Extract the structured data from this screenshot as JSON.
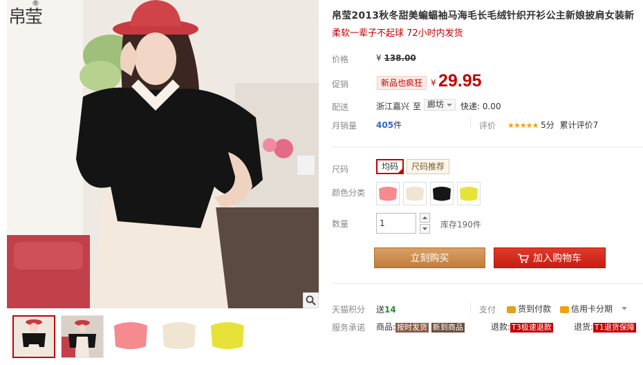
{
  "brand": {
    "logo_text": "帛莹",
    "reg_mark": "®"
  },
  "product": {
    "title": "帛莹2013秋冬甜美蝙蝠袖马海毛长毛绒针织开衫公主新娘披肩女装新",
    "subtitle": "柔软一辈子不起球 72小时内发货"
  },
  "price": {
    "label": "价格",
    "currency": "¥",
    "original": "138.00",
    "promo_label": "促销",
    "promo_badge": "新品也疯狂",
    "promo_currency": "¥",
    "promo_price": "29.95"
  },
  "delivery": {
    "label": "配送",
    "from": "浙江嘉兴",
    "to_word": "至",
    "city": "廊坊",
    "express": "快递: 0.00"
  },
  "sales": {
    "label": "月销量",
    "count": "405",
    "unit": "件",
    "rating_label": "评价",
    "stars": "★★★★★",
    "score": "5分",
    "total_reviews": "累计评价7"
  },
  "options": {
    "size_label": "尺码",
    "size_selected": "均码",
    "size_recommend": "尺码推荐",
    "color_label": "颜色分类",
    "colors": [
      "pink",
      "cream",
      "black",
      "yellow"
    ],
    "qty_label": "数量",
    "qty_value": "1",
    "stock": "库存190件"
  },
  "actions": {
    "buy_now": "立刻购买",
    "add_cart": "加入购物车"
  },
  "points": {
    "label": "天猫积分",
    "send_word": "送",
    "value": "14",
    "pay_label": "支付",
    "cod": "货到付款",
    "credit": "信用卡分期"
  },
  "service": {
    "label": "服务承诺",
    "goods_prefix": "商品:",
    "tag1": "按时发货",
    "tag2": "新到商品",
    "refund_prefix": "退款:",
    "tag3": "T3极速退款",
    "return_prefix": "退货:",
    "tag4": "T1退货保障"
  },
  "colors": {
    "accent": "#c40000",
    "buy": "#c98a4b",
    "cart": "#d42a1e",
    "link": "#3366cc"
  },
  "icons": [
    "logo-icon",
    "zoom-icon",
    "select-caret-icon",
    "qty-up-icon",
    "qty-down-icon",
    "cart-icon",
    "cod-icon",
    "credit-card-icon",
    "dropdown-icon"
  ]
}
